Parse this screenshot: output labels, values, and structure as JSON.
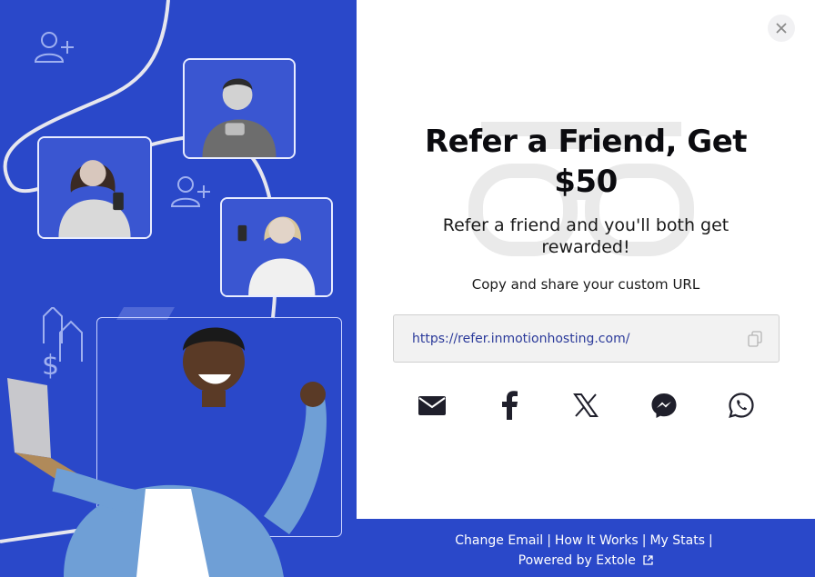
{
  "modal": {
    "title_line1": "Refer a Friend, Get",
    "title_line2": "$50",
    "subtitle_line1": "Refer a friend and you'll both get",
    "subtitle_line2": "rewarded!",
    "copy_label": "Copy and share your custom URL",
    "share_url": "https://refer.inmotionhosting.com/",
    "close_icon": "close-icon",
    "copy_icon": "copy-icon"
  },
  "share": [
    {
      "name": "email-icon"
    },
    {
      "name": "facebook-icon"
    },
    {
      "name": "x-twitter-icon"
    },
    {
      "name": "messenger-icon"
    },
    {
      "name": "whatsapp-icon"
    }
  ],
  "footer": {
    "change_email": "Change Email",
    "how_it_works": "How It Works",
    "my_stats": "My Stats",
    "separator": "|",
    "powered_by": "Powered by Extole"
  },
  "colors": {
    "brand_blue": "#2a48c9",
    "text_dark": "#0b0b0f",
    "url_text": "#2b3a9a"
  }
}
